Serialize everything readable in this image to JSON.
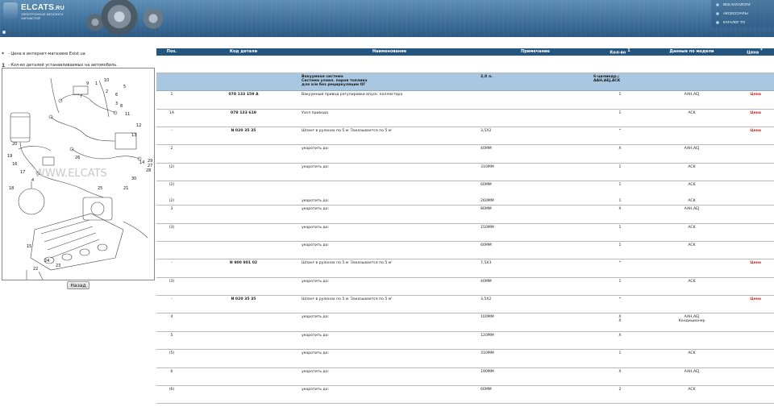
{
  "header": {
    "logo_title": "ELCATS",
    "logo_domain": ".RU",
    "logo_subtitle": "ЭЛЕКТРОННЫЕ КАТАЛОГИ ЗАПЧАСТЕЙ",
    "menu": [
      "ВСЕ КАТАЛОГИ",
      "АКСЕССУАРЫ",
      "КАТАЛОГ ТО"
    ]
  },
  "legend": [
    {
      "mark": "*",
      "text": "- Цена в интернет-магазине Exist.ua"
    },
    {
      "mark": "1",
      "text": "- Кол-во деталей устанавливаемых на автомобиль."
    }
  ],
  "diagram": {
    "watermark": "WWW.ELCATS",
    "callouts": [
      "1",
      "2",
      "3",
      "4",
      "5",
      "6",
      "7",
      "8",
      "9",
      "10",
      "11",
      "12",
      "13",
      "14",
      "15",
      "16",
      "17",
      "18",
      "19",
      "20",
      "21",
      "22",
      "23",
      "24",
      "25",
      "26",
      "27",
      "28",
      "29",
      "30"
    ]
  },
  "back_button": "Назад",
  "table": {
    "columns": [
      {
        "label": "Поз.",
        "sort": ""
      },
      {
        "label": "Код детали",
        "sort": ""
      },
      {
        "label": "Наименование",
        "sort": ""
      },
      {
        "label": "Примечание",
        "sort": ""
      },
      {
        "label": "Кол-во",
        "sort": "1"
      },
      {
        "label": "Данные по модели",
        "sort": ""
      },
      {
        "label": "Цена",
        "sort": "*"
      }
    ],
    "group": {
      "name_lines": [
        "Вакуумная система",
        "Система улавл. паров топлива",
        "для а/м без рециркуляции ОГ"
      ],
      "note": "2,8 л.",
      "model_lines": [
        "6-цилиндр.;",
        "AAH,AEJ,ACK"
      ]
    },
    "rows": [
      {
        "pos": "1",
        "code": "078 133 159 A",
        "name": "Вакуумный привод регулировки впуск. коллектора",
        "note": "",
        "qty": "1",
        "model": "AAH,AEJ",
        "price": "Цена"
      },
      {
        "pos": "1A",
        "code": "078 133 619",
        "name": "Узел привода",
        "note": "",
        "qty": "1",
        "model": "ACK",
        "price": "Цена"
      },
      {
        "pos": "-",
        "code": "N 020 35 35",
        "name": "Шланг в рулонах по 5 м 'Заказывается по 5 м'",
        "note": "3,5X2",
        "qty": "*",
        "model": "",
        "price": "Цена"
      },
      {
        "pos": "2",
        "code": "",
        "name": "укоротить до:",
        "note": "40MM",
        "qty": "X",
        "model": "AAH,AEJ",
        "price": ""
      },
      {
        "pos": "(2)",
        "code": "",
        "name": "укоротить до:",
        "note": "310MM",
        "qty": "1",
        "model": "ACK",
        "price": ""
      },
      {
        "pos": "(2)\n\n\n\n(2)",
        "code": "",
        "name": "\n\n\n\nукоротить до:",
        "note": "60MM\n\n\n\n260MM",
        "qty": "1\n\n\n\n1",
        "model": "ACK\n\n\n\nACK",
        "price": ""
      },
      {
        "pos": "3",
        "code": "",
        "name": "укоротить до:",
        "note": "80MM",
        "qty": "X",
        "model": "AAH,AEJ",
        "price": ""
      },
      {
        "pos": "(3)",
        "code": "",
        "name": "укоротить до:",
        "note": "150MM",
        "qty": "1",
        "model": "ACK",
        "price": ""
      },
      {
        "pos": "",
        "code": "",
        "name": "укоротить до:",
        "note": "60MM",
        "qty": "1",
        "model": "ACK",
        "price": ""
      },
      {
        "pos": "-",
        "code": "N 900 801 02",
        "name": "Шланг в рулонах по 5 м 'Заказывается по 5 м'",
        "note": "7,5X3",
        "qty": "*",
        "model": "",
        "price": "Цена"
      },
      {
        "pos": "(3)",
        "code": "",
        "name": "укоротить до:",
        "note": "40MM",
        "qty": "1",
        "model": "ACK",
        "price": ""
      },
      {
        "pos": "-",
        "code": "N 020 35 35",
        "name": "Шланг в рулонах по 5 м 'Заказывается по 5 м'",
        "note": "3,5X2",
        "qty": "*",
        "model": "",
        "price": "Цена"
      },
      {
        "pos": "4",
        "code": "",
        "name": "укоротить до:",
        "note": "100MM",
        "qty": "X\nX",
        "model": "AAH,AEJ\nКондиционер",
        "price": ""
      },
      {
        "pos": "5",
        "code": "",
        "name": "укоротить до:",
        "note": "120MM",
        "qty": "X",
        "model": "",
        "price": ""
      },
      {
        "pos": "(5)",
        "code": "",
        "name": "укоротить до:",
        "note": "310MM",
        "qty": "1",
        "model": "ACK",
        "price": ""
      },
      {
        "pos": "6",
        "code": "",
        "name": "укоротить до:",
        "note": "190MM",
        "qty": "X",
        "model": "AAH,AEJ",
        "price": ""
      },
      {
        "pos": "(6)",
        "code": "",
        "name": "укоротить до:",
        "note": "60MM",
        "qty": "2",
        "model": "ACK",
        "price": ""
      }
    ]
  },
  "colors": {
    "header_bg": "#3d6f9a",
    "table_header": "#24557f",
    "group_row": "#a9c7e0",
    "price_link": "#d21f1f"
  }
}
